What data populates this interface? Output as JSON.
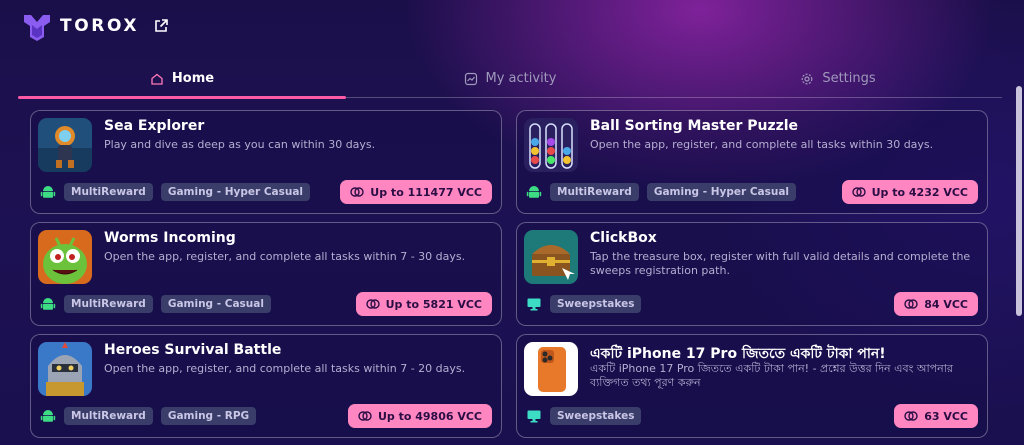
{
  "brand": {
    "name": "TOROX"
  },
  "colors": {
    "accent": "#ff5aa5",
    "reward_bg": "#ff86c0",
    "tag_bg": "#3a3c6a"
  },
  "tabs": [
    {
      "label": "Home",
      "icon": "home-icon",
      "active": true
    },
    {
      "label": "My activity",
      "icon": "activity-icon",
      "active": false
    },
    {
      "label": "Settings",
      "icon": "gear-icon",
      "active": false
    }
  ],
  "offers": [
    {
      "title": "Sea Explorer",
      "description": "Play and dive as deep as you can within 30 days.",
      "platform": "android-icon",
      "tags": [
        "MultiReward",
        "Gaming - Hyper Casual"
      ],
      "reward": "Up to 111477 VCC"
    },
    {
      "title": "Ball Sorting Master Puzzle",
      "description": "Open the app, register, and complete all tasks within 30 days.",
      "platform": "android-icon",
      "tags": [
        "MultiReward",
        "Gaming - Hyper Casual"
      ],
      "reward": "Up to 4232 VCC"
    },
    {
      "title": "Worms Incoming",
      "description": "Open the app, register, and complete all tasks within 7 - 30 days.",
      "platform": "android-icon",
      "tags": [
        "MultiReward",
        "Gaming - Casual"
      ],
      "reward": "Up to 5821 VCC"
    },
    {
      "title": "ClickBox",
      "description": "Tap the treasure box, register with full valid details and complete the sweeps registration path.",
      "platform": "desktop-icon",
      "tags": [
        "Sweepstakes"
      ],
      "reward": "84 VCC"
    },
    {
      "title": "Heroes Survival Battle",
      "description": "Open the app, register, and complete all tasks within 7 - 20 days.",
      "platform": "android-icon",
      "tags": [
        "MultiReward",
        "Gaming - RPG"
      ],
      "reward": "Up to 49806 VCC"
    },
    {
      "title": "একটি iPhone 17 Pro জিততে একটি টাকা পান!",
      "description": "একটি iPhone 17 Pro জিততে একটি টাকা পান! - প্রশ্নের উত্তর দিন এবং আপনার ব্যক্তিগত তথ্য পূরণ করুন",
      "platform": "desktop-icon",
      "tags": [
        "Sweepstakes"
      ],
      "reward": "63 VCC"
    }
  ]
}
